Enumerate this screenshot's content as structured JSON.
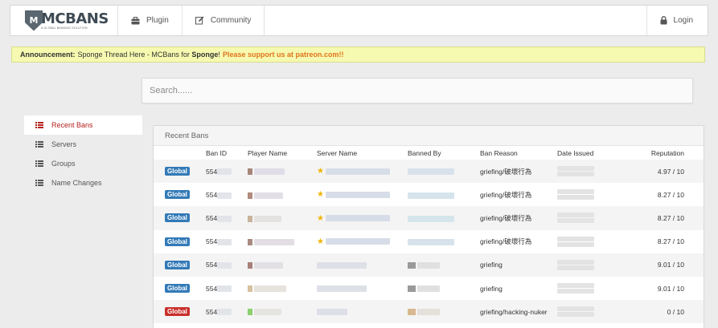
{
  "navbar": {
    "logo_text": "MCBANS",
    "logo_letter": "M",
    "logo_tagline": "A GLOBAL BANNING SOLUTION",
    "items": [
      {
        "label": "Plugin",
        "icon": "briefcase-icon"
      },
      {
        "label": "Community",
        "icon": "edit-icon"
      }
    ],
    "login_label": "Login",
    "login_icon": "lock-icon"
  },
  "announcement": {
    "label": "Announcement:",
    "text_part1": "Sponge Thread Here - MCBans for",
    "text_bold": "Sponge",
    "text_part2": "!",
    "support_text": "Please support us at patreon.com!!"
  },
  "search": {
    "placeholder": "Search......"
  },
  "sidebar": {
    "items": [
      {
        "label": "Recent Bans",
        "active": true,
        "icon": "list-icon"
      },
      {
        "label": "Servers",
        "active": false,
        "icon": "list-icon"
      },
      {
        "label": "Groups",
        "active": false,
        "icon": "list-icon"
      },
      {
        "label": "Name Changes",
        "active": false,
        "icon": "list-icon"
      }
    ]
  },
  "panel": {
    "title": "Recent Bans",
    "columns": [
      "",
      "Ban ID",
      "Player Name",
      "Server Name",
      "Banned By",
      "Ban Reason",
      "Date Issued",
      "Reputation"
    ],
    "rows": [
      {
        "badge": "Global",
        "badge_color": "#337ab7",
        "ban_id": "554",
        "reason": "griefing/破壞行為",
        "reputation": "4.97 / 10"
      },
      {
        "badge": "Global",
        "badge_color": "#337ab7",
        "ban_id": "554",
        "reason": "griefing/破壞行為",
        "reputation": "8.27 / 10"
      },
      {
        "badge": "Global",
        "badge_color": "#337ab7",
        "ban_id": "554",
        "reason": "griefing/破壞行為",
        "reputation": "8.27 / 10"
      },
      {
        "badge": "Global",
        "badge_color": "#337ab7",
        "ban_id": "554",
        "reason": "griefing/破壞行為",
        "reputation": "8.27 / 10"
      },
      {
        "badge": "Global",
        "badge_color": "#337ab7",
        "ban_id": "554",
        "reason": "griefing",
        "reputation": "9.01 / 10"
      },
      {
        "badge": "Global",
        "badge_color": "#337ab7",
        "ban_id": "554",
        "reason": "griefing",
        "reputation": "9.01 / 10"
      },
      {
        "badge": "Global",
        "badge_color": "#c9302c",
        "ban_id": "554",
        "reason": "griefing/hacking-nuker",
        "reputation": "0 / 10"
      }
    ]
  },
  "colors": {
    "accent": "#b5211d",
    "announce_bg": "#f6fab0",
    "support": "#e0741e"
  }
}
